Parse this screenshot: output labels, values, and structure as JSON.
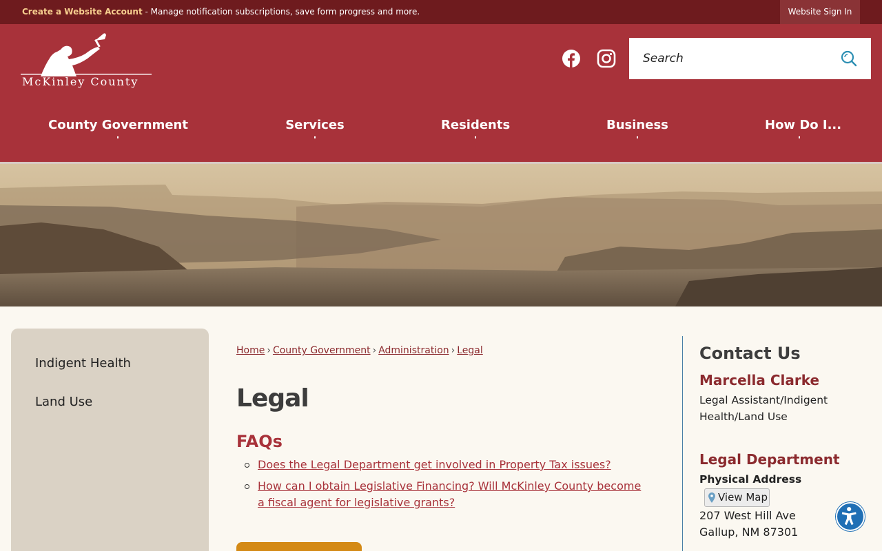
{
  "topbar": {
    "account_link": "Create a Website Account",
    "account_desc": " - Manage notification subscriptions, save form progress and more.",
    "signin_label": "Website Sign In"
  },
  "header": {
    "logo_text": "McKinley County",
    "search_placeholder": "Search",
    "social": [
      "facebook-icon",
      "instagram-icon"
    ]
  },
  "nav": [
    {
      "label": "County Government"
    },
    {
      "label": "Services"
    },
    {
      "label": "Residents"
    },
    {
      "label": "Business"
    },
    {
      "label": "How Do I..."
    }
  ],
  "sidebar": {
    "items": [
      {
        "label": "Indigent Health"
      },
      {
        "label": "Land Use"
      }
    ]
  },
  "breadcrumb": [
    {
      "label": "Home"
    },
    {
      "label": "County Government"
    },
    {
      "label": "Administration"
    },
    {
      "label": "Legal"
    }
  ],
  "breadcrumb_sep": "›",
  "main": {
    "title": "Legal",
    "faq_heading": "FAQs",
    "faqs": [
      {
        "label": "Does the Legal Department get involved in Property Tax issues?"
      },
      {
        "label": "How can I obtain Legislative Financing? Will McKinley County become a fiscal agent for legislative grants?"
      }
    ]
  },
  "contact": {
    "title": "Contact Us",
    "name": "Marcella Clarke",
    "role": "Legal Assistant/Indigent Health/Land Use",
    "dept": "Legal Department",
    "address_label": "Physical Address",
    "map_label": "View Map",
    "address_line1": "207 West Hill Ave",
    "address_line2": "Gallup, NM 87301"
  },
  "colors": {
    "topbar": "#6e1b1e",
    "header": "#a8323a",
    "accent": "#8b2a2e",
    "button": "#d48a16",
    "accessibility": "#1f6fb5"
  }
}
